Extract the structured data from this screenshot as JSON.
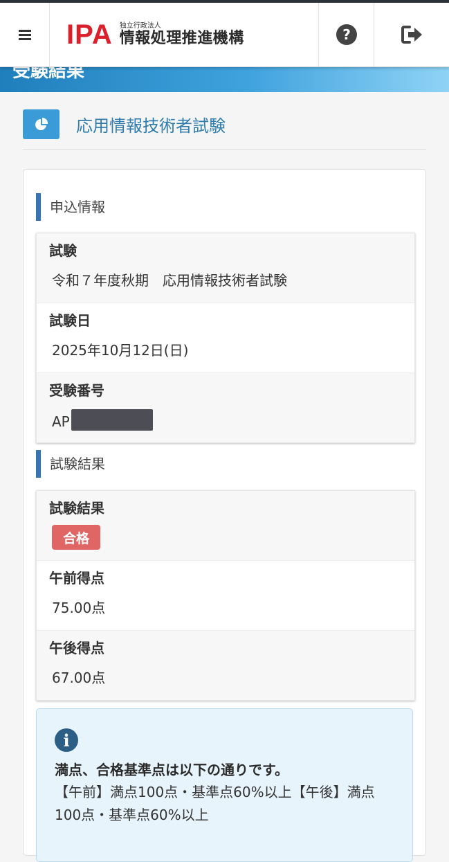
{
  "header": {
    "menu_icon": "hamburger-icon",
    "logo": {
      "mark": "IPA",
      "sub": "独立行政法人",
      "name": "情報処理推進機構"
    },
    "help_icon": "question-circle-icon",
    "logout_icon": "sign-out-icon"
  },
  "banner": {
    "title": "受験結果"
  },
  "exam": {
    "icon": "pie-chart-icon",
    "title": "応用情報技術者試験"
  },
  "application": {
    "section_title": "申込情報",
    "exam_label": "試験",
    "exam_value": "令和７年度秋期　応用情報技術者試験",
    "date_label": "試験日",
    "date_value": "2025年10月12日(日)",
    "number_label": "受験番号",
    "number_prefix": "AP"
  },
  "result": {
    "section_title": "試験結果",
    "result_label": "試験結果",
    "result_badge": "合格",
    "am_label": "午前得点",
    "am_value": "75.00点",
    "pm_label": "午後得点",
    "pm_value": "67.00点"
  },
  "notice": {
    "icon": "info-icon",
    "title": "満点、合格基準点は以下の通りです。",
    "body": "【午前】満点100点・基準点60%以上【午後】満点100点・基準点60%以上"
  },
  "colors": {
    "accent": "#3a9bd6",
    "pass_badge": "#e06666",
    "section_bar": "#3575b5"
  }
}
